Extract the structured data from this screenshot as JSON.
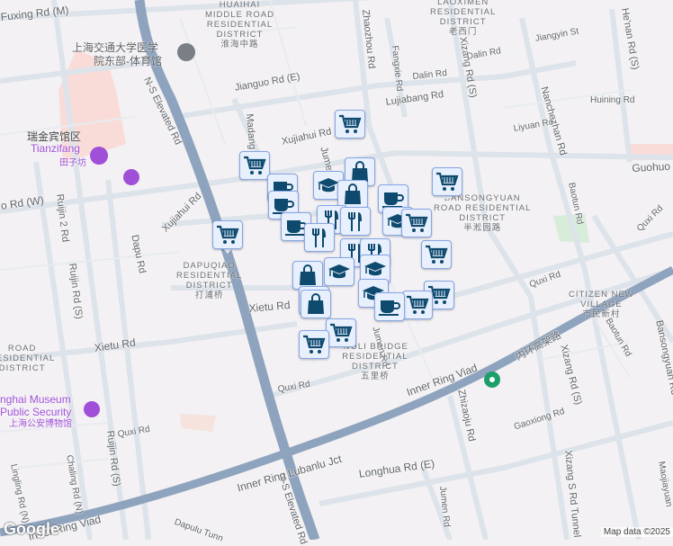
{
  "roads": {
    "fuxing": "Fuxing Rd (M)",
    "ns_elevated": "N-S Elevated Rd",
    "ns_elevated_2": "N-S Elevated Rd",
    "jianguo": "Jianguo Rd (E)",
    "madang": "Madang Rd",
    "xujiahui": "Xujiahui Rd",
    "xujiahui_w": "Xujiahui Rd",
    "jumen_top": "Jumen Rd",
    "jumen_bottom": "Jumen Rd",
    "zhaozhou": "Zhaozhou Rd",
    "fangxie": "Fangxie Rd",
    "xizang_s": "Xizang Rd (S)",
    "xizang_s_bottom": "Xizang Rd (S)",
    "xizang_s_tunnel": "Xizang S Rd Tunnel",
    "dalin": "Dalin Rd",
    "dalin2": "Dalin Rd",
    "jiangyin": "Jiangyin St",
    "lujiabang": "Lujiabang Rd",
    "liyuan": "Liyuan Rd",
    "nanchezhan": "Nanchezhan Rd",
    "henan": "He'nan Rd (S)",
    "huining": "Huining Rd",
    "guohuo": "Guohuo",
    "baotun": "Baotun Rd",
    "baotun2": "Baotun Rd",
    "quxi": "Quxi Rd",
    "quxi2": "Quxi Rd",
    "quxi3": "Quxi Rd",
    "quxi4": "Quxi Rd",
    "xietu": "Xietu Rd",
    "xietu2": "Xietu Rd",
    "ruijin2": "Ruijin 2 Rd",
    "ruijin_s": "Ruijin Rd (S)",
    "ruijin_s2": "Ruijin Rd (S)",
    "dapu": "Dapu Rd",
    "rd_w": "o Rd (W)",
    "inner_ring": "Inner Ring Viad",
    "inner_ring2": "Inner Ring Viad",
    "inner_ring_cn": "内环高架路",
    "lubanlu": "Inner Ring Lubanlu Jct",
    "zhizaoju": "Zhizaoju Rd",
    "gaoxiong": "Gaoxiong Rd",
    "longhua": "Longhua Rd (E)",
    "jumen_s": "Jumen Rd",
    "chaling": "Chaling Rd (N)",
    "lingling": "Lingling Rd (N)",
    "dapulu_tunnel": "Dapulu Tunn",
    "bansongyuan": "Bansongyuan Rd",
    "maojiayuan": "Maojiayuan"
  },
  "districts": {
    "huaihai": {
      "name": [
        "HUAIHAI",
        "MIDDLE ROAD",
        "RESIDENTIAL",
        "DISTRICT"
      ],
      "cn": "淮海中路"
    },
    "laoximen": {
      "name": [
        "LAOXIMEN",
        "RESIDENTIAL",
        "DISTRICT"
      ],
      "cn": "老西门"
    },
    "songyuan": {
      "name": [
        "BANSONGYUAN",
        "ROAD RESIDENTIAL",
        "DISTRICT"
      ],
      "cn": "半淞园路"
    },
    "dapuqiao": {
      "name": [
        "DAPUQIAO",
        "RESIDENTIAL",
        "DISTRICT"
      ],
      "cn": "打浦桥"
    },
    "wuli": {
      "name": [
        "WULI BRIDGE",
        "RESIDENTIAL",
        "DISTRICT"
      ],
      "cn": "五里桥"
    },
    "citizen": {
      "name": [
        "CITIZEN NEW",
        "VILLAGE"
      ],
      "cn": "市民新村"
    },
    "road_left": {
      "name": [
        "ROAD",
        "RESIDENTIAL",
        "DISTRICT"
      ]
    }
  },
  "pois": {
    "hospital": [
      "上海交通大学医学",
      "院东部-体育馆"
    ],
    "ruijin_hotel": "瑞金宾馆区",
    "tianzifang": "Tianzifang",
    "tianzifang_cn": "田子坊",
    "museum": [
      "nghai Museum",
      "Public Security"
    ],
    "museum_cn": "上海公安博物馆"
  },
  "marker_types": [
    "shopping-cart",
    "shopping-bag",
    "graduation-cap",
    "coffee-cup",
    "fork-knife"
  ],
  "colors": {
    "marker_fill": "#e8effd",
    "marker_border": "#86a6e4",
    "marker_icon": "#0d4a6e",
    "poi_purple": "#a050d8",
    "elevated": "#8ea3bd"
  },
  "footer": {
    "logo": "Google",
    "attribution": "Map data ©2025"
  }
}
